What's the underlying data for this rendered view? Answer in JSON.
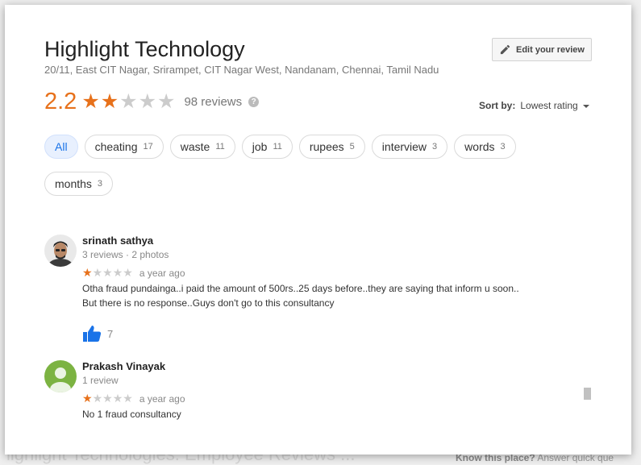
{
  "place": {
    "title": "Highlight Technology",
    "address": "20/11, East CIT Nagar, Srirampet, CIT Nagar West, Nandanam, Chennai, Tamil Nadu"
  },
  "edit_button": {
    "label": "Edit your review",
    "icon": "pencil-icon"
  },
  "rating": {
    "value": "2.2",
    "stars_filled": 2,
    "stars_total": 5,
    "reviews_label": "98 reviews",
    "help_icon": "?"
  },
  "sort": {
    "label": "Sort by:",
    "value": "Lowest rating"
  },
  "chips": [
    {
      "label": "All",
      "count": "",
      "active": true
    },
    {
      "label": "cheating",
      "count": "17"
    },
    {
      "label": "waste",
      "count": "11"
    },
    {
      "label": "job",
      "count": "11"
    },
    {
      "label": "rupees",
      "count": "5"
    },
    {
      "label": "interview",
      "count": "3"
    },
    {
      "label": "words",
      "count": "3"
    },
    {
      "label": "months",
      "count": "3"
    }
  ],
  "reviews": [
    {
      "name": "srinath sathya",
      "meta": "3 reviews · 2 photos",
      "stars": 1,
      "time": "a year ago",
      "text_line1": "Otha fraud pundainga..i paid the amount of 500rs..25 days before..they are saying that inform u soon..",
      "text_line2": "But there is no response..Guys don't go to this consultancy",
      "likes": "7"
    },
    {
      "name": "Prakash Vinayak",
      "meta": "1 review",
      "stars": 1,
      "time": "a year ago",
      "text_line1": "No 1 fraud consultancy"
    }
  ],
  "background": {
    "footer_question": "Know this place?",
    "footer_link": "Answer quick que",
    "bottom_heading": "lighlight Technologies: Employee Reviews ..."
  },
  "colors": {
    "accent_star": "#e7711b",
    "like_blue": "#1a73e8",
    "chip_active_bg": "#e8f0fe"
  }
}
